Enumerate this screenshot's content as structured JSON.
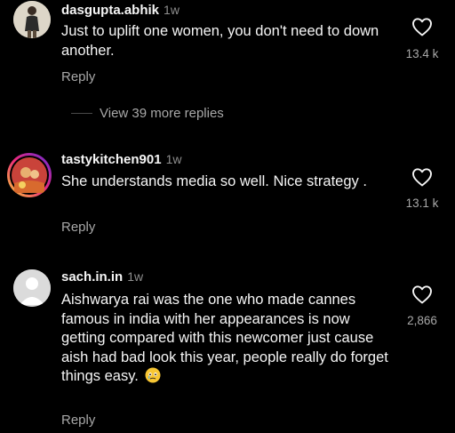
{
  "comments": [
    {
      "username": "dasgupta.abhik",
      "time": "1w",
      "text": "Just to uplift one women, you don't need to down another.",
      "likes": "13.4 k",
      "reply_label": "Reply",
      "avatar_icon": "user-avatar-photo"
    },
    {
      "username": "tastykitchen901",
      "time": "1w",
      "text": "She understands media so well. Nice strategy .",
      "likes": "13.1 k",
      "reply_label": "Reply",
      "avatar_icon": "user-avatar-story-ring"
    },
    {
      "username": "sach.in.in",
      "time": "1w",
      "text": "Aishwarya rai was the one who made cannes famous in india with her appearances is now getting compared with this newcomer just cause aish had bad look this year, people really do forget things easy.",
      "emoji": "face-holding-back-tears-emoji",
      "likes": "2,866",
      "reply_label": "Reply",
      "avatar_icon": "default-avatar-icon"
    }
  ],
  "view_more_replies": "View 39 more replies",
  "colors": {
    "background": "#000000",
    "primary_text": "#f5f5f5",
    "secondary_text": "#a8a8a8",
    "story_ring": "#c13584"
  }
}
